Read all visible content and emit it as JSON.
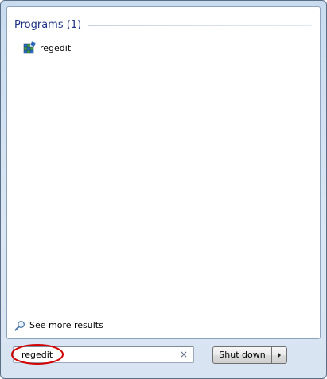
{
  "results": {
    "group_title": "Programs (1)",
    "items": [
      {
        "label": "regedit",
        "icon": "regedit-icon"
      }
    ],
    "see_more_label": "See more results"
  },
  "search": {
    "value": "regedit",
    "clear_glyph": "×"
  },
  "shutdown": {
    "label": "Shut down"
  },
  "colors": {
    "group_title": "#1e3287",
    "highlight_ellipse": "#d40000"
  }
}
